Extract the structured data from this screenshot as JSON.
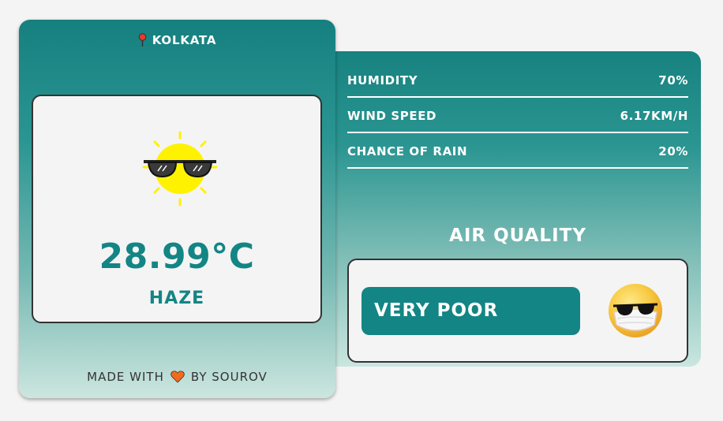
{
  "location": {
    "city": "KOLKATA",
    "icon": "map-pin-icon"
  },
  "weather": {
    "temperature": "28.99°C",
    "condition": "HAZE",
    "icon": "sun-with-sunglasses-icon"
  },
  "stats": [
    {
      "label": "HUMIDITY",
      "value": "70%"
    },
    {
      "label": "WIND SPEED",
      "value": "6.17KM/H"
    },
    {
      "label": "CHANCE OF RAIN",
      "value": "20%"
    }
  ],
  "air_quality": {
    "title": "AIR QUALITY",
    "status": "VERY POOR",
    "icon": "masked-face-sunglasses-icon"
  },
  "footer": {
    "prefix": "MADE WITH",
    "suffix": "BY SOUROV",
    "icon": "heart-icon"
  },
  "colors": {
    "accent": "#138585",
    "heart": "#f26b1d",
    "sun": "#fff200",
    "pin": "#e63b2e"
  }
}
